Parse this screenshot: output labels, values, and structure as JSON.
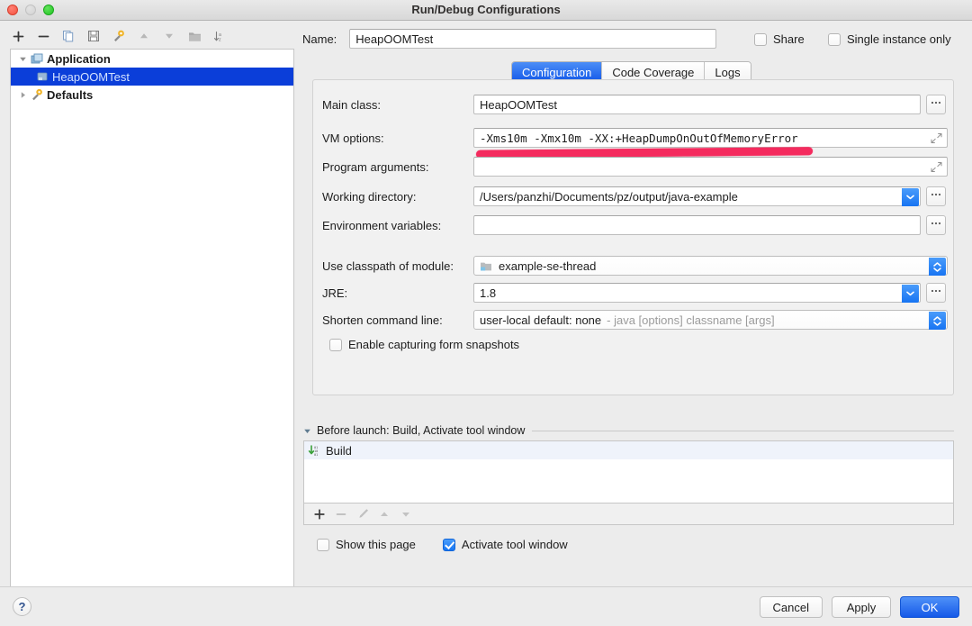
{
  "window": {
    "title": "Run/Debug Configurations",
    "traffic_lights": [
      "close-button",
      "minimize-button",
      "zoom-button"
    ]
  },
  "left_toolbar": {
    "items": [
      {
        "name": "add-configuration-button",
        "icon": "plus-icon",
        "label": "+"
      },
      {
        "name": "remove-configuration-button",
        "icon": "minus-icon",
        "label": "−"
      },
      {
        "name": "copy-configuration-button",
        "icon": "copy-icon",
        "label": ""
      },
      {
        "name": "save-configuration-button",
        "icon": "save-icon",
        "label": ""
      },
      {
        "name": "edit-defaults-button",
        "icon": "wrench-icon",
        "label": ""
      },
      {
        "name": "move-up-button",
        "icon": "arrow-up-icon",
        "label": ""
      },
      {
        "name": "move-down-button",
        "icon": "arrow-down-icon",
        "label": ""
      },
      {
        "name": "new-folder-button",
        "icon": "folder-icon",
        "label": ""
      },
      {
        "name": "sort-configurations-button",
        "icon": "sort-az-icon",
        "label": ""
      }
    ]
  },
  "tree": {
    "nodes": [
      {
        "label": "Application",
        "level": 0,
        "expanded": true,
        "icon": "application-icon",
        "selected": false
      },
      {
        "label": "HeapOOMTest",
        "level": 1,
        "expanded": null,
        "icon": "run-config-icon",
        "selected": true
      },
      {
        "label": "Defaults",
        "level": 0,
        "expanded": false,
        "icon": "defaults-wrench-icon",
        "selected": false
      }
    ]
  },
  "name_row": {
    "label": "Name:",
    "value": "HeapOOMTest",
    "placeholder": ""
  },
  "top_checkboxes": [
    {
      "label": "Share",
      "checked": false,
      "name": "share-checkbox"
    },
    {
      "label": "Single instance only",
      "checked": false,
      "name": "single-instance-only-checkbox"
    }
  ],
  "tabs": [
    {
      "label": "Configuration",
      "active": true
    },
    {
      "label": "Code Coverage",
      "active": false
    },
    {
      "label": "Logs",
      "active": false
    }
  ],
  "fields": {
    "main_class": {
      "label": "Main class:",
      "value": "HeapOOMTest",
      "browse_label": "•••"
    },
    "vm_options": {
      "label": "VM options:",
      "value": "-Xms10m -Xmx10m -XX:+HeapDumpOnOutOfMemoryError"
    },
    "program_arguments": {
      "label": "Program arguments:",
      "value": ""
    },
    "working_directory": {
      "label": "Working directory:",
      "value": "/Users/panzhi/Documents/pz/output/java-example",
      "browse_label": "•••"
    },
    "environment_variables": {
      "label": "Environment variables:",
      "value": "",
      "browse_label": "•••"
    },
    "use_classpath_of_module": {
      "label": "Use classpath of module:",
      "value": "example-se-thread",
      "icon": "module-icon"
    },
    "jre": {
      "label": "JRE:",
      "value": "1.8",
      "browse_label": "•••"
    },
    "shorten_command_line": {
      "label": "Shorten command line:",
      "value": "user-local default: none",
      "hint": "- java [options] classname [args]"
    },
    "enable_capturing_form_snapshots": {
      "label": "Enable capturing form snapshots",
      "checked": false
    }
  },
  "before_launch": {
    "header": "Before launch: Build, Activate tool window",
    "rows": [
      {
        "label": "Build",
        "icon": "build-icon"
      }
    ],
    "toolbar": [
      {
        "name": "add-task-button",
        "icon": "plus-icon",
        "enabled": true
      },
      {
        "name": "remove-task-button",
        "icon": "minus-icon",
        "enabled": false
      },
      {
        "name": "edit-task-button",
        "icon": "pencil-icon",
        "enabled": false
      },
      {
        "name": "move-task-up-button",
        "icon": "arrow-up-icon",
        "enabled": false
      },
      {
        "name": "move-task-down-button",
        "icon": "arrow-down-icon",
        "enabled": false
      }
    ]
  },
  "footer_checkboxes": [
    {
      "label": "Show this page",
      "checked": false,
      "name": "show-this-page-checkbox"
    },
    {
      "label": "Activate tool window",
      "checked": true,
      "name": "activate-tool-window-checkbox"
    }
  ],
  "footer_buttons": {
    "help": "?",
    "cancel": "Cancel",
    "apply": "Apply",
    "ok": "OK"
  },
  "annotation": {
    "type": "highlighter-stroke",
    "color": "#f42b5e"
  },
  "colors": {
    "accent_blue": "#1559e8",
    "selection_blue": "#0b3ed9",
    "marker_pink": "#f42b5e",
    "window_bg": "#ececec"
  }
}
